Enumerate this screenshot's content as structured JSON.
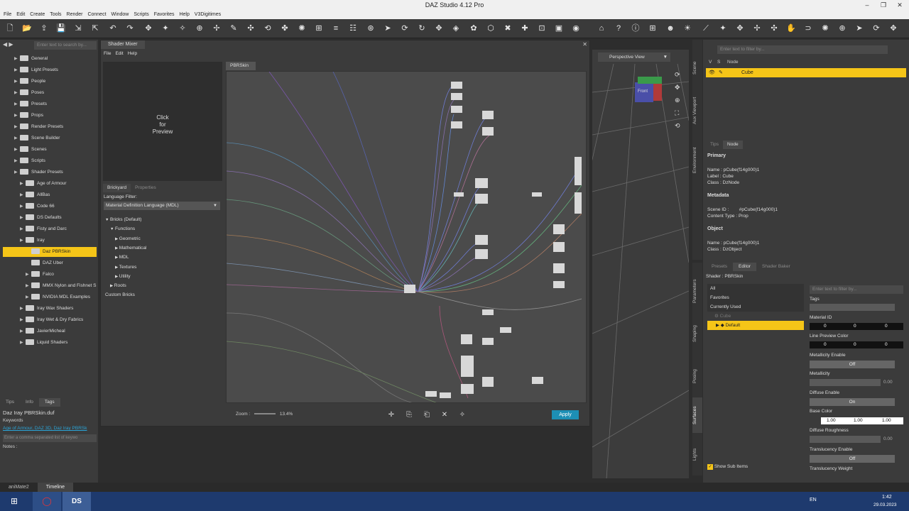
{
  "window": {
    "title": "DAZ Studio 4.12 Pro",
    "minimize": "–",
    "restore": "❐",
    "close": "✕"
  },
  "menu": [
    "File",
    "Edit",
    "Create",
    "Tools",
    "Render",
    "Connect",
    "Window",
    "Scripts",
    "Favorites",
    "Help",
    "V3Digitimes"
  ],
  "content_library": {
    "search_placeholder": "Enter text to search by...",
    "items": [
      {
        "label": "General",
        "level": 1
      },
      {
        "label": "Light Presets",
        "level": 1
      },
      {
        "label": "People",
        "level": 1
      },
      {
        "label": "Poses",
        "level": 1
      },
      {
        "label": "Presets",
        "level": 1
      },
      {
        "label": "Props",
        "level": 1
      },
      {
        "label": "Render Presets",
        "level": 1
      },
      {
        "label": "Scene Builder",
        "level": 1
      },
      {
        "label": "Scenes",
        "level": 1
      },
      {
        "label": "Scripts",
        "level": 1
      },
      {
        "label": "Shader Presets",
        "level": 1
      },
      {
        "label": "Age of Armour",
        "level": 2
      },
      {
        "label": "AllBas",
        "level": 2
      },
      {
        "label": "Code 66",
        "level": 2
      },
      {
        "label": "DS Defaults",
        "level": 2
      },
      {
        "label": "Fisty and Darc",
        "level": 2
      },
      {
        "label": "Iray",
        "level": 2
      },
      {
        "label": "Daz PBRSkin",
        "level": 3,
        "selected": true
      },
      {
        "label": "DAZ Uber",
        "level": 3
      },
      {
        "label": "Falco",
        "level": 3
      },
      {
        "label": "MMX Nylon and Fishnet S",
        "level": 3
      },
      {
        "label": "NVIDIA MDL Examples",
        "level": 3
      },
      {
        "label": "Iray Wax Shaders",
        "level": 2
      },
      {
        "label": "Iray Wet & Dry Fabrics",
        "level": 2
      },
      {
        "label": "JavierMicheal",
        "level": 2
      },
      {
        "label": "Liquid Shaders",
        "level": 2
      }
    ],
    "tabs": [
      "Tips",
      "Info",
      "Tags"
    ],
    "active_tab": "Tags",
    "file_name": "Daz Iray PBRSkin.duf",
    "keywords_label": "Keywords",
    "keywords_value": "Age of Armour, DAZ 3D, Daz Iray PBRSk",
    "keywords_placeholder": "Enter a comma separated list of keywo",
    "notes_label": "Notes :"
  },
  "shader_mixer": {
    "title": "Shader Mixer",
    "menu": [
      "File",
      "Edit",
      "Help"
    ],
    "preview_text": [
      "Click",
      "for",
      "Preview"
    ],
    "tabs": [
      "Brickyard",
      "Properties"
    ],
    "language_filter_label": "Language Filter:",
    "language_filter_value": "Material Definition Language (MDL)",
    "bricks": [
      {
        "label": "Bricks (Default)",
        "level": 0,
        "open": true
      },
      {
        "label": "Functions",
        "level": 1,
        "open": true
      },
      {
        "label": "Geometric",
        "level": 2
      },
      {
        "label": "Mathematical",
        "level": 2
      },
      {
        "label": "MDL",
        "level": 2
      },
      {
        "label": "Textures",
        "level": 2
      },
      {
        "label": "Utility",
        "level": 2
      },
      {
        "label": "Roots",
        "level": 1
      },
      {
        "label": "Custom Bricks",
        "level": 0
      }
    ],
    "canvas_tab": "PBRSkin",
    "zoom_label": "Zoom :",
    "zoom_value": "13.4%",
    "apply_label": "Apply"
  },
  "viewport": {
    "view_label": "Perspective View",
    "cube_label": "Front"
  },
  "scene": {
    "search_placeholder": "Enter text to filter by...",
    "col_v": "V",
    "col_s": "S",
    "col_node": "Node",
    "node": "Cube"
  },
  "info": {
    "tabs": [
      "Tips",
      "Node"
    ],
    "primary_label": "Primary",
    "primary_name": "Name : pCube(f14g000)1",
    "primary_label_val": "Label : Cube",
    "primary_class": "Class : DzNode",
    "metadata_label": "Metadata",
    "scene_id": "Scene ID :        #pCube(f14g000)1",
    "content_type": "Content Type : Prop",
    "object_label": "Object",
    "object_name": "Name : pCube(f14g000)1",
    "object_class": "Class : DzObject"
  },
  "surfaces": {
    "tabs": [
      "Presets",
      "Editor",
      "Shader Baker"
    ],
    "shader_label": "Shader : PBRSkin",
    "groups": [
      "All",
      "Favorites",
      "Currently Used"
    ],
    "tree_cube": "Cube",
    "tree_default": "Default",
    "filter_placeholder": "Enter text to filter by...",
    "tags_label": "Tags",
    "props": {
      "material_id": "Material ID",
      "material_id_vals": [
        "0",
        "0",
        "0"
      ],
      "line_preview": "Line Preview Color",
      "line_preview_vals": [
        "0",
        "0",
        "0"
      ],
      "metallicity_enable": "Metallicity Enable",
      "metallicity_enable_val": "Off",
      "metallicity": "Metallicity",
      "metallicity_val": "0.00",
      "diffuse_enable": "Diffuse Enable",
      "diffuse_enable_val": "On",
      "base_color": "Base Color",
      "base_color_vals": [
        "1.00",
        "1.00",
        "1.00"
      ],
      "diffuse_roughness": "Diffuse Roughness",
      "diffuse_roughness_val": "0.00",
      "translucency_enable": "Translucency Enable",
      "translucency_enable_val": "Off",
      "translucency_weight": "Translucency Weight"
    },
    "show_sub_items": "Show Sub Items"
  },
  "side_tabs_right": [
    "Scene",
    "Aux Viewport",
    "Environment"
  ],
  "side_tabs_right2": [
    "Parameters",
    "Shaping",
    "Posing",
    "Surfaces",
    "Lights"
  ],
  "bottom_tabs": [
    "aniMate2",
    "Timeline"
  ],
  "taskbar": {
    "lang": "EN",
    "time": "1:42",
    "date": "29.03.2023"
  },
  "colors": {
    "accent": "#f5c518",
    "apply": "#1d8fb5"
  }
}
